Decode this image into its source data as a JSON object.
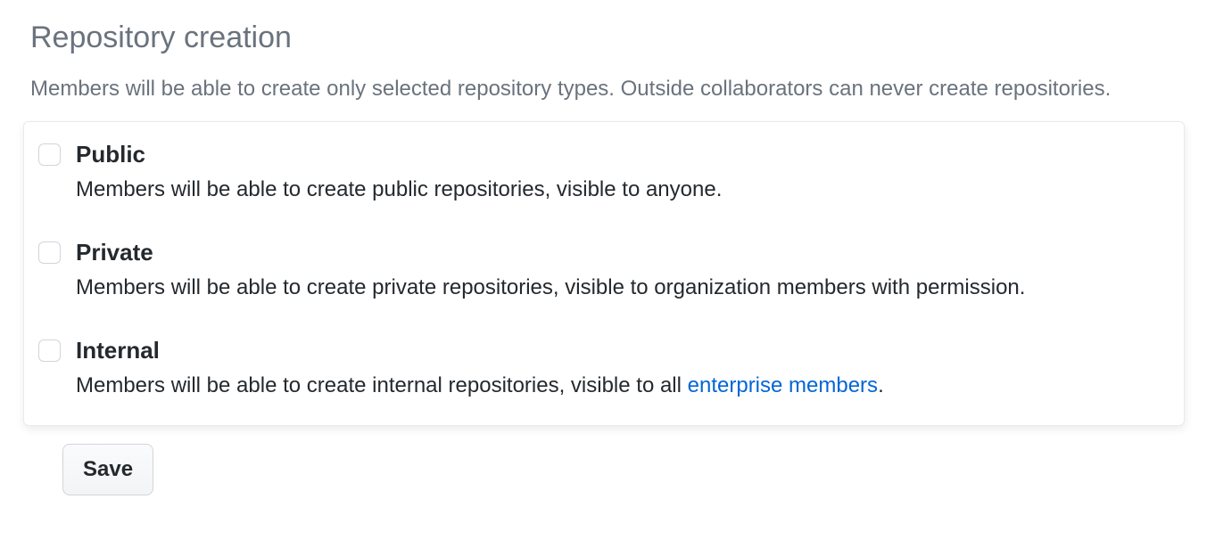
{
  "section": {
    "title": "Repository creation",
    "description": "Members will be able to create only selected repository types. Outside collaborators can never create repositories."
  },
  "options": {
    "public": {
      "label": "Public",
      "description": "Members will be able to create public repositories, visible to anyone.",
      "checked": false
    },
    "private": {
      "label": "Private",
      "description": "Members will be able to create private repositories, visible to organization members with permission.",
      "checked": false
    },
    "internal": {
      "label": "Internal",
      "description_prefix": "Members will be able to create internal repositories, visible to all ",
      "link_text": "enterprise members",
      "description_suffix": ".",
      "checked": false
    }
  },
  "actions": {
    "save_label": "Save"
  }
}
